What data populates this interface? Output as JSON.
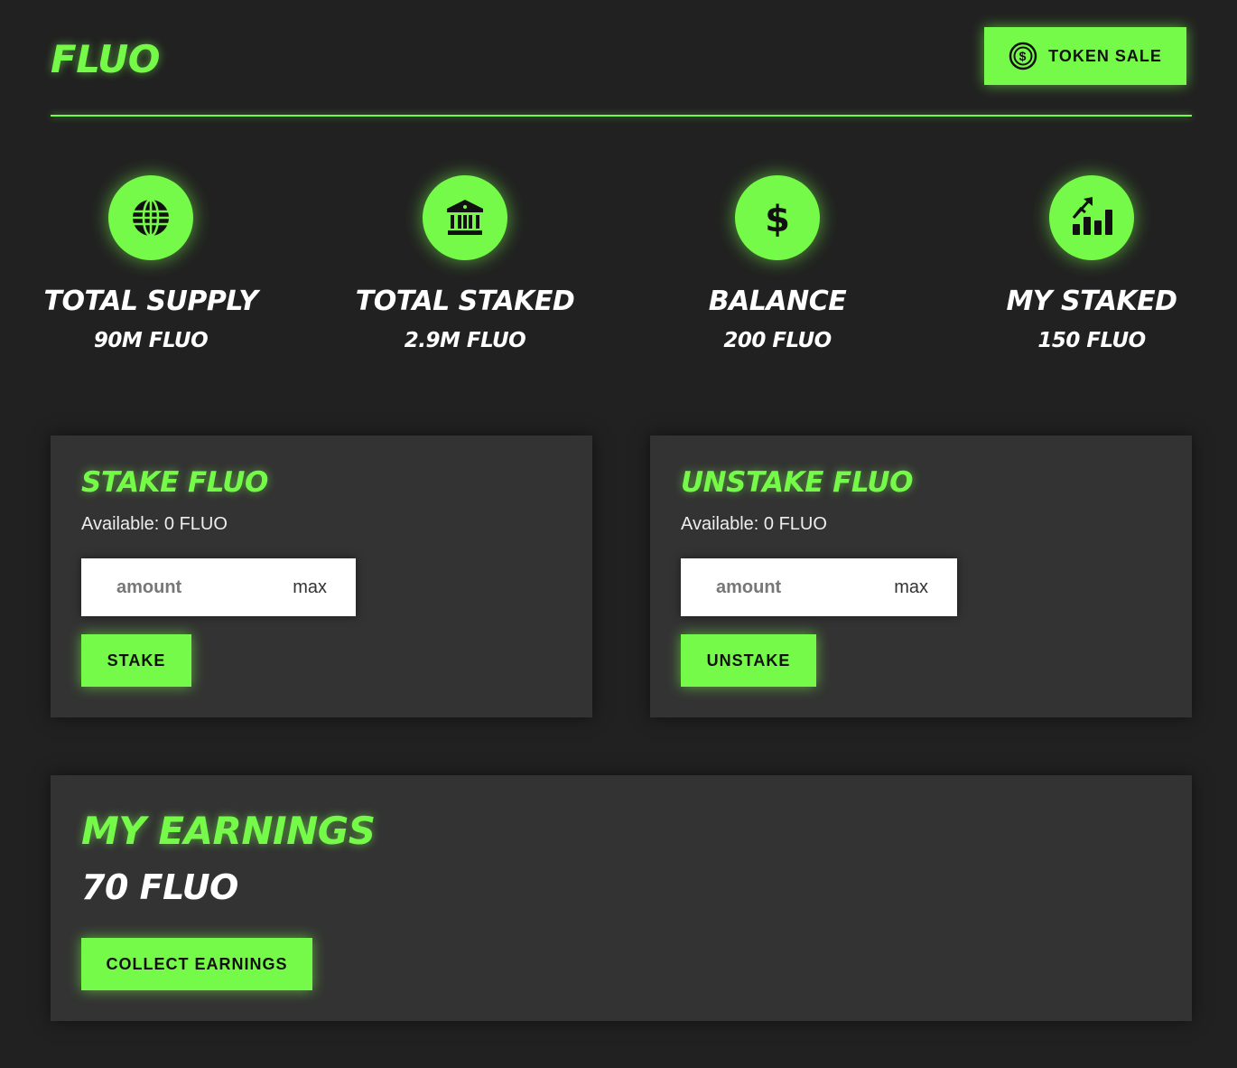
{
  "header": {
    "brand": "FLUO",
    "token_sale_label": "TOKEN SALE",
    "token_sale_icon": "dollar-coin-icon"
  },
  "stats": [
    {
      "icon": "globe-icon",
      "label": "TOTAL SUPPLY",
      "value": "90M FLUO"
    },
    {
      "icon": "bank-icon",
      "label": "TOTAL STAKED",
      "value": "2.9M FLUO"
    },
    {
      "icon": "dollar-icon",
      "label": "BALANCE",
      "value": "200 FLUO"
    },
    {
      "icon": "growth-chart-icon",
      "label": "MY STAKED",
      "value": "150 FLUO"
    }
  ],
  "stake": {
    "title": "STAKE FLUO",
    "available": "Available: 0 FLUO",
    "placeholder": "amount",
    "max_label": "max",
    "button_label": "STAKE"
  },
  "unstake": {
    "title": "UNSTAKE FLUO",
    "available": "Available: 0 FLUO",
    "placeholder": "amount",
    "max_label": "max",
    "button_label": "UNSTAKE"
  },
  "earnings": {
    "title": "MY EARNINGS",
    "value": "70 FLUO",
    "button_label": "COLLECT EARNINGS"
  },
  "colors": {
    "accent": "#76fa49",
    "background": "#212121",
    "card": "#333333"
  }
}
